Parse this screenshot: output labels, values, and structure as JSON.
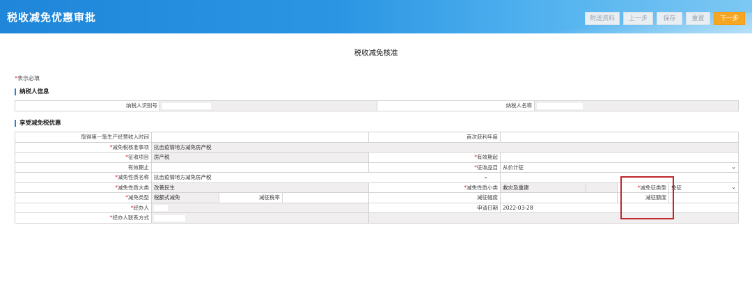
{
  "header": {
    "title": "税收减免优惠审批",
    "buttons": {
      "attach": "附送资料",
      "prev": "上一步",
      "save": "保存",
      "reset": "重置",
      "next": "下一步"
    }
  },
  "page_title": "税收减免核准",
  "required_note": "表示必填",
  "sections": {
    "taxpayer": "纳税人信息",
    "preferential": "享受减免税优惠"
  },
  "taxpayer": {
    "id_label": "纳税人识别号",
    "name_label": "纳税人名称"
  },
  "form": {
    "first_income_label": "取得第一笔生产经营收入时间",
    "first_profit_label": "首次获利年度",
    "approval_matter_label": "减免税核准事项",
    "approval_matter_value": "抗击疫情地方减免房产税",
    "levy_item_label": "征收项目",
    "levy_item_value": "房产税",
    "valid_from_label": "有效期起",
    "valid_to_label": "有效期止",
    "levy_subitem_label": "征收品目",
    "levy_subitem_value": "从价计征",
    "nature_name_label": "减免性质名称",
    "nature_name_value": "抗击疫情地方减免房产税",
    "nature_major_label": "减免性质大类",
    "nature_major_value": "改善民生",
    "nature_minor_label": "减免性质小类",
    "nature_minor_value": "救灾及重建",
    "exempt_type_label": "减免征类型",
    "exempt_type_value": "免征",
    "reduce_type_label": "减免类型",
    "reduce_type_value": "税额式减免",
    "reduce_rate_label": "减征税率",
    "reduce_range_label": "减征幅度",
    "reduce_amount_label": "减征额度",
    "handler_label": "经办人",
    "apply_date_label": "申请日期",
    "apply_date_value": "2022-03-28",
    "handler_contact_label": "经办人联系方式"
  },
  "icons": {
    "dropdown": "chevron-down-icon"
  }
}
